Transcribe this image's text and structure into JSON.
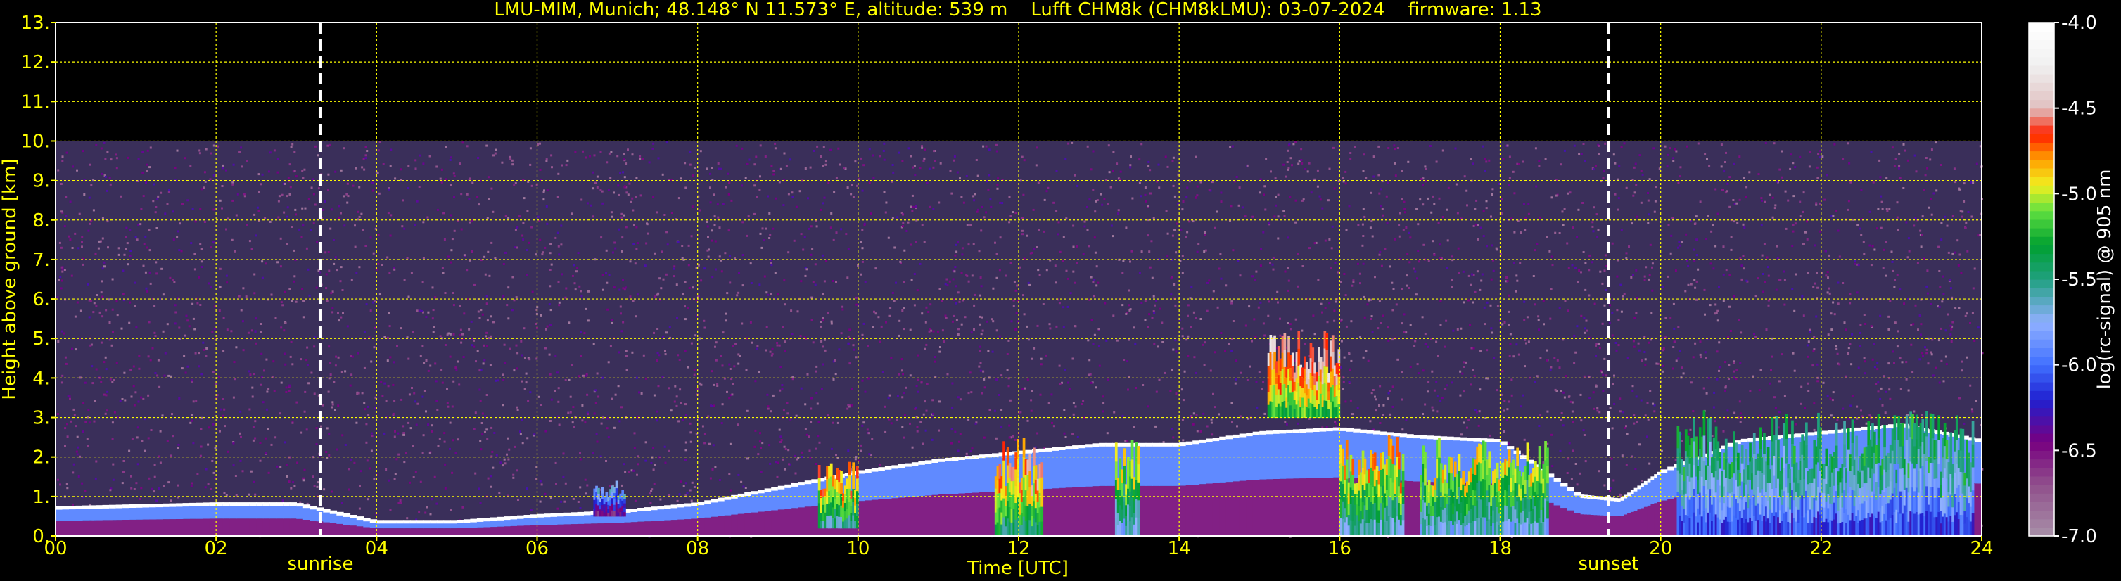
{
  "chart_data": {
    "type": "heatmap",
    "title": "LMU-MIM, Munich; 48.148° N 11.573° E, altitude: 539 m    Lufft CHM8k (CHM8kLMU): 03-07-2024    firmware: 1.13",
    "xlabel": "Time [UTC]",
    "ylabel": "Height above ground [km]",
    "colorbar_label": "log(rc-signal) @ 905 nm",
    "xlim": [
      0,
      24
    ],
    "ylim": [
      0,
      13
    ],
    "x_ticks": [
      "00",
      "02",
      "04",
      "06",
      "08",
      "10",
      "12",
      "14",
      "16",
      "18",
      "20",
      "22",
      "24"
    ],
    "y_ticks": [
      "0.",
      "1.",
      "2.",
      "3.",
      "4.",
      "5.",
      "6.",
      "7.",
      "8.",
      "9.",
      "10.",
      "11.",
      "12.",
      "13."
    ],
    "colorbar_ticks": [
      "-4.0",
      "-4.5",
      "-5.0",
      "-5.5",
      "-6.0",
      "-6.5",
      "-7.0"
    ],
    "colorbar_range": [
      -7.0,
      -4.0
    ],
    "grid": true,
    "sunrise": {
      "label": "sunrise",
      "time": 3.3
    },
    "sunset": {
      "label": "sunset",
      "time": 19.35
    },
    "noise_top_km": 10,
    "boundary_layer_top": [
      [
        0,
        0.7
      ],
      [
        1,
        0.75
      ],
      [
        2,
        0.8
      ],
      [
        3,
        0.8
      ],
      [
        4,
        0.35
      ],
      [
        5,
        0.35
      ],
      [
        6,
        0.5
      ],
      [
        7,
        0.6
      ],
      [
        8,
        0.8
      ],
      [
        9,
        1.2
      ],
      [
        10,
        1.6
      ],
      [
        11,
        1.9
      ],
      [
        12,
        2.1
      ],
      [
        13,
        2.3
      ],
      [
        14,
        2.3
      ],
      [
        15,
        2.6
      ],
      [
        16,
        2.7
      ],
      [
        17,
        2.5
      ],
      [
        18,
        2.4
      ],
      [
        19,
        1.0
      ],
      [
        19.5,
        0.9
      ],
      [
        20,
        1.6
      ],
      [
        21,
        2.4
      ],
      [
        22,
        2.6
      ],
      [
        23,
        2.8
      ],
      [
        24,
        2.4
      ]
    ],
    "cloud_features": [
      {
        "t0": 15.1,
        "t1": 16.0,
        "h0": 3.0,
        "h1": 5.2,
        "level": -4.3
      },
      {
        "t0": 6.7,
        "t1": 7.1,
        "h0": 0.5,
        "h1": 1.4,
        "level": -5.6
      },
      {
        "t0": 9.5,
        "t1": 10.0,
        "h0": 0.2,
        "h1": 1.9,
        "level": -4.6
      },
      {
        "t0": 11.7,
        "t1": 12.3,
        "h0": 0.0,
        "h1": 2.5,
        "level": -4.5
      },
      {
        "t0": 13.2,
        "t1": 13.5,
        "h0": 0.0,
        "h1": 2.5,
        "level": -4.8
      },
      {
        "t0": 16.0,
        "t1": 16.8,
        "h0": 0.0,
        "h1": 2.6,
        "level": -4.7
      },
      {
        "t0": 17.0,
        "t1": 18.6,
        "h0": 0.0,
        "h1": 2.5,
        "level": -4.8
      },
      {
        "t0": 20.2,
        "t1": 23.9,
        "h0": 0.0,
        "h1": 3.2,
        "level": -5.2
      }
    ]
  }
}
